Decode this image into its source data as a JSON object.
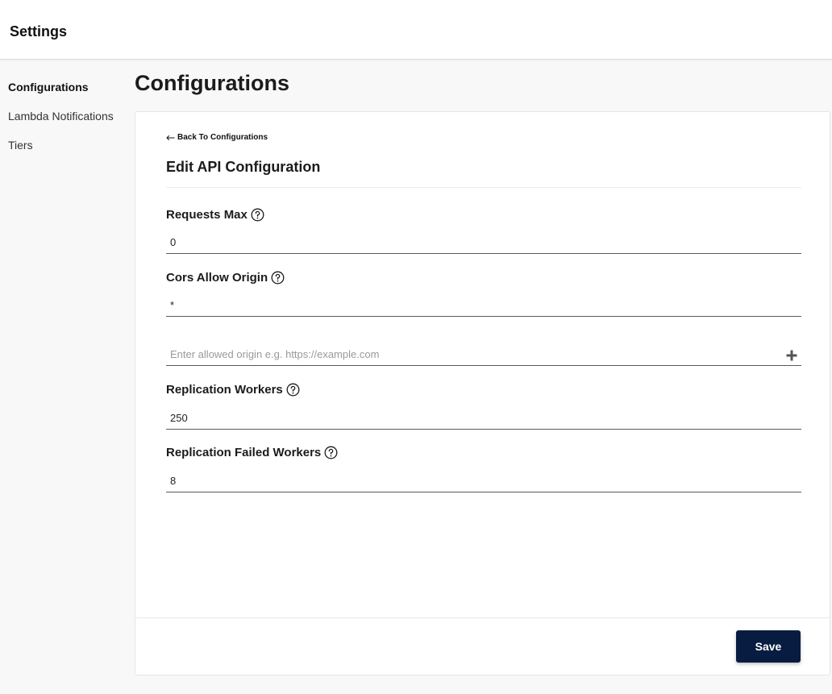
{
  "header": {
    "title": "Settings"
  },
  "sidebar": {
    "items": [
      {
        "label": "Configurations",
        "active": true
      },
      {
        "label": "Lambda Notifications",
        "active": false
      },
      {
        "label": "Tiers",
        "active": false
      }
    ]
  },
  "main": {
    "page_title": "Configurations",
    "back_link": "Back To Configurations",
    "form_title": "Edit API Configuration",
    "fields": {
      "requests_max": {
        "label": "Requests Max",
        "value": "0"
      },
      "cors_allow_origin": {
        "label": "Cors Allow Origin",
        "value": "*",
        "new_origin_placeholder": "Enter allowed origin e.g. https://example.com"
      },
      "replication_workers": {
        "label": "Replication Workers",
        "value": "250"
      },
      "replication_failed_workers": {
        "label": "Replication Failed Workers",
        "value": "8"
      }
    },
    "save_label": "Save"
  },
  "icons": {
    "help": "question-circle-icon",
    "add": "plus-icon",
    "back": "arrow-left-icon"
  },
  "colors": {
    "primary_button": "#081c42",
    "background": "#f8f8f8"
  }
}
